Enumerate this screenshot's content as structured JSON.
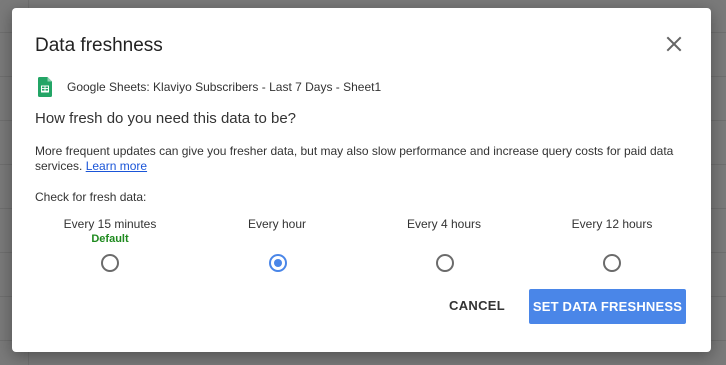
{
  "dialog": {
    "title": "Data freshness",
    "close_icon": "close-icon",
    "source": {
      "icon": "google-sheets-icon",
      "text": "Google Sheets: Klaviyo Subscribers - Last 7 Days - Sheet1"
    },
    "question": "How fresh do you need this data to be?",
    "description": "More frequent updates can give you fresher data, but may also slow performance and increase query costs for paid data services.",
    "learn_more": "Learn more",
    "check_label": "Check for fresh data:",
    "options": [
      {
        "label": "Every 15 minutes",
        "note": "Default",
        "selected": false
      },
      {
        "label": "Every hour",
        "note": "",
        "selected": true
      },
      {
        "label": "Every 4 hours",
        "note": "",
        "selected": false
      },
      {
        "label": "Every 12 hours",
        "note": "",
        "selected": false
      }
    ],
    "cancel_label": "CANCEL",
    "submit_label": "SET DATA FRESHNESS"
  },
  "colors": {
    "accent": "#4a86e8",
    "default_note": "#1e8a1e",
    "link": "#1a55d8",
    "overlay": "#7a7a7a"
  }
}
